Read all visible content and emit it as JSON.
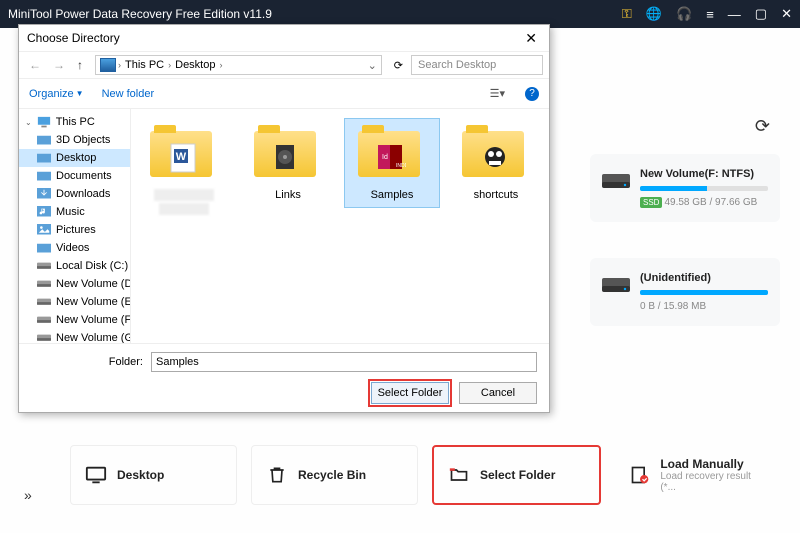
{
  "titlebar": {
    "title": "MiniTool Power Data Recovery Free Edition v11.9"
  },
  "drives": [
    {
      "name": "New Volume(F: NTFS)",
      "fill_pct": 52,
      "size": "49.58 GB / 97.66 GB",
      "ssd": true
    },
    {
      "name": "(Unidentified)",
      "fill_pct": 100,
      "size": "0 B / 15.98 MB",
      "ssd": false
    }
  ],
  "actions": {
    "desktop": "Desktop",
    "recyclebin": "Recycle Bin",
    "selectfolder": "Select Folder",
    "loadmanually": "Load Manually",
    "loadmanually_sub": "Load recovery result (*..."
  },
  "dialog": {
    "title": "Choose Directory",
    "path": {
      "seg1": "This PC",
      "seg2": "Desktop"
    },
    "search_placeholder": "Search Desktop",
    "toolbar": {
      "organize": "Organize",
      "newfolder": "New folder"
    },
    "tree": {
      "thispc": "This PC",
      "items": [
        "3D Objects",
        "Desktop",
        "Documents",
        "Downloads",
        "Music",
        "Pictures",
        "Videos",
        "Local Disk (C:)",
        "New Volume (D:)",
        "New Volume (E:)",
        "New Volume (F:)",
        "New Volume (G:)"
      ],
      "selected_index": 1
    },
    "files": [
      {
        "label": "",
        "type": "word"
      },
      {
        "label": "Links",
        "type": "links"
      },
      {
        "label": "Samples",
        "type": "samples",
        "selected": true
      },
      {
        "label": "shortcuts",
        "type": "shortcuts"
      }
    ],
    "footer": {
      "folder_label": "Folder:",
      "folder_value": "Samples",
      "select_btn": "Select Folder",
      "cancel_btn": "Cancel"
    }
  }
}
